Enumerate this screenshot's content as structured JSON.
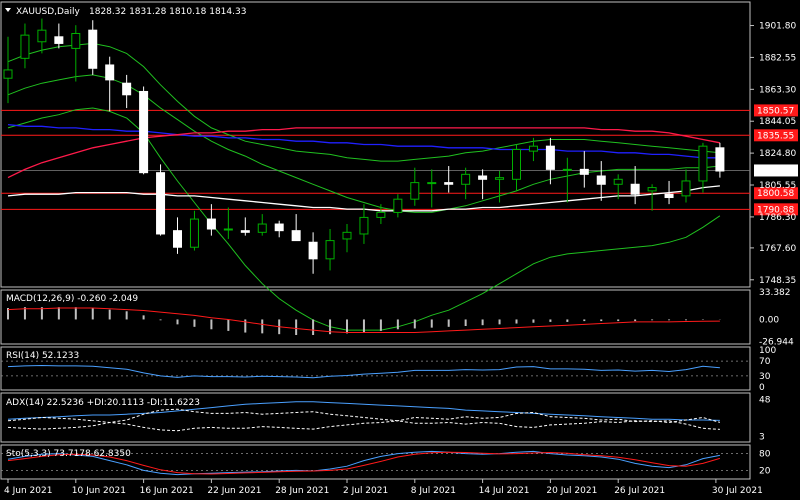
{
  "symbol_header": "XAUUSD,Daily",
  "ohlc_header": "1828.32 1831.28 1810.18 1814.33",
  "colors": {
    "background": "#000000",
    "frame": "#c0c0c0",
    "candle_up": "#00b000",
    "candle_down": "#ffffff",
    "ma_blue": "#2020ff",
    "ma_red": "#ff1a4a",
    "ma_white": "#ffffff",
    "bollinger": "#20c020",
    "level_line": "#ff1a1a",
    "price_tag": "#ff1a1a",
    "current_tag": "#ffffff",
    "macd_hist": "#c0c0c0",
    "macd_signal": "#ff1a1a",
    "rsi_line": "#4aa0ff",
    "adx_line": "#4aa0ff",
    "stoch_main": "#4aa0ff",
    "stoch_signal": "#ff1a1a"
  },
  "chart_data": [
    {
      "type": "candlestick",
      "title": "XAUUSD,Daily",
      "ylim": [
        1744,
        1916
      ],
      "yticks": [
        "1901.80",
        "1882.55",
        "1863.30",
        "1844.05",
        "1824.80",
        "1805.55",
        "1786.30",
        "1767.60",
        "1748.35"
      ],
      "xticks": [
        "4 Jun 2021",
        "10 Jun 2021",
        "16 Jun 2021",
        "22 Jun 2021",
        "28 Jun 2021",
        "2 Jul 2021",
        "8 Jul 2021",
        "14 Jul 2021",
        "20 Jul 2021",
        "26 Jul 2021",
        "30 Jul 2021"
      ],
      "horizontal_levels": [
        {
          "value": 1850.57,
          "label": "1850.57"
        },
        {
          "value": 1835.55,
          "label": "1835.55"
        },
        {
          "value": 1800.58,
          "label": "1800.58"
        },
        {
          "value": 1790.88,
          "label": "1790.88"
        }
      ],
      "current_price": {
        "value": 1814.33,
        "label": "1814.33"
      },
      "candles": [
        {
          "o": 1870,
          "h": 1895,
          "l": 1855,
          "c": 1875
        },
        {
          "o": 1882,
          "h": 1903,
          "l": 1876,
          "c": 1896
        },
        {
          "o": 1892,
          "h": 1906,
          "l": 1885,
          "c": 1899
        },
        {
          "o": 1895,
          "h": 1903,
          "l": 1888,
          "c": 1891
        },
        {
          "o": 1888,
          "h": 1902,
          "l": 1868,
          "c": 1897
        },
        {
          "o": 1899,
          "h": 1905,
          "l": 1872,
          "c": 1876
        },
        {
          "o": 1878,
          "h": 1883,
          "l": 1850,
          "c": 1869
        },
        {
          "o": 1867,
          "h": 1872,
          "l": 1852,
          "c": 1860
        },
        {
          "o": 1862,
          "h": 1865,
          "l": 1812,
          "c": 1813
        },
        {
          "o": 1813,
          "h": 1818,
          "l": 1775,
          "c": 1776
        },
        {
          "o": 1778,
          "h": 1786,
          "l": 1764,
          "c": 1768
        },
        {
          "o": 1768,
          "h": 1790,
          "l": 1766,
          "c": 1785
        },
        {
          "o": 1785,
          "h": 1794,
          "l": 1775,
          "c": 1779
        },
        {
          "o": 1779,
          "h": 1792,
          "l": 1773,
          "c": 1779
        },
        {
          "o": 1778,
          "h": 1786,
          "l": 1775,
          "c": 1777
        },
        {
          "o": 1777,
          "h": 1788,
          "l": 1775,
          "c": 1782
        },
        {
          "o": 1782,
          "h": 1784,
          "l": 1774,
          "c": 1778
        },
        {
          "o": 1778,
          "h": 1788,
          "l": 1773,
          "c": 1772
        },
        {
          "o": 1771,
          "h": 1777,
          "l": 1752,
          "c": 1761
        },
        {
          "o": 1761,
          "h": 1779,
          "l": 1754,
          "c": 1772
        },
        {
          "o": 1773,
          "h": 1782,
          "l": 1765,
          "c": 1777
        },
        {
          "o": 1776,
          "h": 1794,
          "l": 1770,
          "c": 1786
        },
        {
          "o": 1786,
          "h": 1794,
          "l": 1782,
          "c": 1789
        },
        {
          "o": 1789,
          "h": 1800,
          "l": 1786,
          "c": 1797
        },
        {
          "o": 1797,
          "h": 1816,
          "l": 1793,
          "c": 1807
        },
        {
          "o": 1807,
          "h": 1815,
          "l": 1792,
          "c": 1807
        },
        {
          "o": 1807,
          "h": 1817,
          "l": 1801,
          "c": 1806
        },
        {
          "o": 1806,
          "h": 1816,
          "l": 1797,
          "c": 1812
        },
        {
          "o": 1811,
          "h": 1815,
          "l": 1797,
          "c": 1809
        },
        {
          "o": 1809,
          "h": 1814,
          "l": 1795,
          "c": 1810
        },
        {
          "o": 1809,
          "h": 1830,
          "l": 1802,
          "c": 1827
        },
        {
          "o": 1826,
          "h": 1834,
          "l": 1820,
          "c": 1829
        },
        {
          "o": 1829,
          "h": 1834,
          "l": 1806,
          "c": 1815
        },
        {
          "o": 1815,
          "h": 1822,
          "l": 1795,
          "c": 1815
        },
        {
          "o": 1815,
          "h": 1826,
          "l": 1804,
          "c": 1812
        },
        {
          "o": 1811,
          "h": 1820,
          "l": 1796,
          "c": 1806
        },
        {
          "o": 1806,
          "h": 1812,
          "l": 1797,
          "c": 1809
        },
        {
          "o": 1806,
          "h": 1817,
          "l": 1794,
          "c": 1800
        },
        {
          "o": 1802,
          "h": 1806,
          "l": 1790,
          "c": 1804
        },
        {
          "o": 1800,
          "h": 1808,
          "l": 1794,
          "c": 1798
        },
        {
          "o": 1799,
          "h": 1815,
          "l": 1795,
          "c": 1808
        },
        {
          "o": 1808,
          "h": 1831,
          "l": 1801,
          "c": 1829
        },
        {
          "o": 1828,
          "h": 1831,
          "l": 1810,
          "c": 1814
        }
      ],
      "ma_blue": [
        1842,
        1841,
        1841,
        1840,
        1840,
        1839,
        1839,
        1838,
        1838,
        1837,
        1836,
        1835,
        1835,
        1834,
        1834,
        1833,
        1833,
        1832,
        1832,
        1831,
        1831,
        1830,
        1830,
        1829,
        1829,
        1829,
        1828,
        1828,
        1828,
        1827,
        1827,
        1827,
        1827,
        1826,
        1826,
        1826,
        1825,
        1825,
        1824,
        1824,
        1823,
        1822,
        1822
      ],
      "ma_red": [
        1810,
        1815,
        1819,
        1822,
        1825,
        1828,
        1830,
        1832,
        1834,
        1835,
        1836,
        1837,
        1837,
        1838,
        1838,
        1839,
        1839,
        1840,
        1840,
        1840,
        1840,
        1840,
        1840,
        1840,
        1840,
        1840,
        1840,
        1840,
        1840,
        1840,
        1840,
        1840,
        1840,
        1840,
        1840,
        1839,
        1839,
        1838,
        1838,
        1837,
        1835,
        1833,
        1831
      ],
      "ma_white": [
        1799,
        1800,
        1800,
        1800,
        1801,
        1801,
        1801,
        1801,
        1800,
        1800,
        1799,
        1799,
        1798,
        1797,
        1796,
        1795,
        1794,
        1793,
        1792,
        1792,
        1791,
        1791,
        1790,
        1790,
        1790,
        1790,
        1791,
        1791,
        1792,
        1792,
        1793,
        1794,
        1795,
        1796,
        1797,
        1798,
        1799,
        1799,
        1800,
        1801,
        1802,
        1804,
        1805
      ],
      "bb_upper": [
        1880,
        1884,
        1887,
        1889,
        1890,
        1891,
        1889,
        1885,
        1877,
        1866,
        1856,
        1847,
        1840,
        1836,
        1832,
        1830,
        1828,
        1826,
        1825,
        1824,
        1822,
        1821,
        1820,
        1820,
        1821,
        1822,
        1823,
        1825,
        1826,
        1828,
        1830,
        1832,
        1833,
        1833,
        1833,
        1832,
        1831,
        1830,
        1829,
        1828,
        1827,
        1826,
        1825
      ],
      "bb_middle": [
        1860,
        1864,
        1867,
        1869,
        1871,
        1872,
        1870,
        1866,
        1860,
        1852,
        1845,
        1838,
        1832,
        1827,
        1823,
        1818,
        1814,
        1810,
        1806,
        1802,
        1798,
        1795,
        1792,
        1790,
        1789,
        1789,
        1791,
        1793,
        1796,
        1799,
        1802,
        1806,
        1809,
        1811,
        1813,
        1814,
        1815,
        1815,
        1815,
        1815,
        1816,
        1816,
        1817
      ],
      "bb_lower": [
        1840,
        1843,
        1846,
        1848,
        1851,
        1852,
        1850,
        1846,
        1837,
        1822,
        1808,
        1795,
        1782,
        1770,
        1757,
        1746,
        1737,
        1730,
        1724,
        1720,
        1718,
        1718,
        1718,
        1720,
        1723,
        1727,
        1730,
        1735,
        1740,
        1746,
        1752,
        1758,
        1762,
        1764,
        1765,
        1766,
        1767,
        1768,
        1769,
        1771,
        1774,
        1780,
        1787
      ]
    },
    {
      "type": "bar",
      "title": "MACD(12,26,9) -0.260 -2.049",
      "yticks": [
        "33.382",
        "0.00",
        "-26.944"
      ],
      "ylim": [
        -30,
        36
      ],
      "values": [
        14,
        15,
        15,
        15,
        15,
        14,
        12,
        10,
        5,
        -1,
        -6,
        -9,
        -12,
        -14,
        -16,
        -17,
        -18,
        -19,
        -19,
        -18,
        -17,
        -16,
        -14,
        -12,
        -11,
        -10,
        -9,
        -8,
        -7,
        -6,
        -5,
        -4,
        -3,
        -3,
        -2,
        -2,
        -2,
        -2,
        -1,
        -1,
        -1,
        -0.5,
        -0.26
      ],
      "signal": [
        12,
        13,
        13,
        14,
        14,
        14,
        13,
        12,
        11,
        9,
        7,
        5,
        2,
        0,
        -3,
        -6,
        -9,
        -11,
        -13,
        -15,
        -16,
        -16,
        -16,
        -16,
        -16,
        -15,
        -14,
        -13,
        -12,
        -11,
        -10,
        -9,
        -8,
        -7,
        -6,
        -5,
        -4,
        -3,
        -3,
        -3,
        -2.5,
        -2.2,
        -2.05
      ]
    },
    {
      "type": "line",
      "title": "RSI(14) 52.1233",
      "yticks": [
        "100",
        "70",
        "30",
        "0"
      ],
      "ylim": [
        0,
        100
      ],
      "levels": [
        70,
        30
      ],
      "values": [
        55,
        57,
        58,
        57,
        57,
        56,
        52,
        48,
        38,
        30,
        26,
        30,
        28,
        28,
        27,
        29,
        28,
        27,
        25,
        29,
        31,
        35,
        37,
        40,
        45,
        45,
        45,
        47,
        46,
        47,
        54,
        55,
        49,
        49,
        48,
        45,
        46,
        43,
        45,
        42,
        47,
        56,
        52
      ]
    },
    {
      "type": "line",
      "title": "ADX(14) 22.5236 +DI:20.1113 -DI:11.6223",
      "yticks": [
        "48",
        "3"
      ],
      "ylim": [
        0,
        52
      ],
      "adx": [
        24,
        25,
        26,
        27,
        28,
        29,
        29,
        30,
        31,
        32,
        34,
        36,
        38,
        40,
        42,
        43,
        44,
        45,
        45,
        44,
        43,
        42,
        41,
        40,
        39,
        38,
        37,
        35,
        34,
        33,
        32,
        31,
        30,
        29,
        28,
        27,
        26,
        25,
        24,
        24,
        23,
        23,
        22.5
      ],
      "plus_di": [
        22,
        24,
        26,
        25,
        24,
        22,
        20,
        18,
        14,
        11,
        10,
        13,
        14,
        13,
        13,
        15,
        14,
        13,
        12,
        15,
        17,
        19,
        20,
        22,
        26,
        25,
        24,
        27,
        25,
        26,
        31,
        32,
        27,
        26,
        25,
        23,
        24,
        21,
        22,
        20,
        23,
        26,
        20.1
      ],
      "minus_di": [
        14,
        13,
        12,
        13,
        14,
        16,
        20,
        23,
        30,
        35,
        36,
        33,
        31,
        31,
        32,
        30,
        31,
        32,
        33,
        30,
        28,
        26,
        24,
        22,
        19,
        19,
        20,
        18,
        20,
        19,
        15,
        14,
        17,
        18,
        19,
        21,
        20,
        22,
        21,
        22,
        18,
        13,
        11.6
      ]
    },
    {
      "type": "line",
      "title": "Sto(5,3,3) 73.7178 62.8350",
      "yticks": [
        "80",
        "20"
      ],
      "ylim": [
        0,
        100
      ],
      "levels": [
        80,
        20
      ],
      "main": [
        60,
        70,
        78,
        80,
        75,
        70,
        55,
        40,
        20,
        10,
        5,
        8,
        10,
        12,
        14,
        15,
        18,
        20,
        18,
        25,
        35,
        55,
        70,
        80,
        85,
        88,
        85,
        80,
        78,
        80,
        85,
        88,
        80,
        75,
        72,
        68,
        60,
        45,
        35,
        30,
        40,
        62,
        73.7
      ],
      "signal": [
        55,
        62,
        70,
        76,
        78,
        75,
        68,
        55,
        38,
        22,
        12,
        8,
        7,
        9,
        11,
        13,
        15,
        17,
        18,
        20,
        25,
        38,
        52,
        68,
        78,
        83,
        85,
        84,
        81,
        79,
        80,
        82,
        84,
        81,
        76,
        72,
        67,
        58,
        47,
        37,
        35,
        45,
        62.8
      ]
    }
  ]
}
